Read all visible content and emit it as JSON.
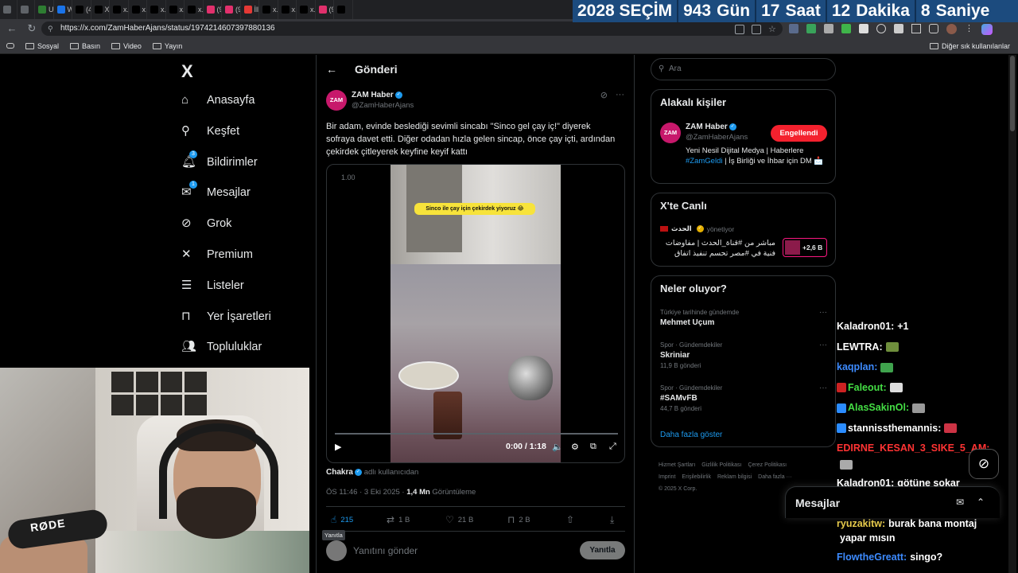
{
  "browser": {
    "tabs": [
      {
        "label": "",
        "color": "#5f6368"
      },
      {
        "label": "",
        "color": "#5f6368"
      },
      {
        "label": "URL",
        "color": "#2e7d32"
      },
      {
        "label": "Wat",
        "color": "#1a73e8"
      },
      {
        "label": "(4) X",
        "color": "#000000"
      },
      {
        "label": "X'te",
        "color": "#000000"
      },
      {
        "label": "x.co",
        "color": "#000000"
      },
      {
        "label": "x.co",
        "color": "#000000"
      },
      {
        "label": "x.co",
        "color": "#000000"
      },
      {
        "label": "x.co",
        "color": "#000000"
      },
      {
        "label": "x.co",
        "color": "#000000"
      },
      {
        "label": "(9) I",
        "color": "#e1306c"
      },
      {
        "label": "(9) I",
        "color": "#e1306c"
      },
      {
        "label": "İlk o",
        "color": "#e53935"
      },
      {
        "label": "x.co",
        "color": "#000000"
      },
      {
        "label": "x.co",
        "color": "#000000"
      },
      {
        "label": "x.co",
        "color": "#000000"
      },
      {
        "label": "(9) I",
        "color": "#e1306c"
      },
      {
        "label": "",
        "color": "#000000"
      }
    ],
    "url": "https://x.com/ZamHaberAjans/status/1974214607397880136",
    "bookmarks": [
      "Sosyal",
      "Basın",
      "Video",
      "Yayın"
    ],
    "bookmarks_other": "Diğer sık kullanılanlar"
  },
  "countdown": {
    "title": "2028 SEÇİM",
    "days": "943",
    "days_label": "Gün",
    "hours": "17",
    "hours_label": "Saat",
    "minutes": "12",
    "minutes_label": "Dakika",
    "seconds": "8",
    "seconds_label": "Saniye"
  },
  "nav": {
    "logo": "X",
    "items": [
      {
        "label": "Anasayfa",
        "icon": "home-icon"
      },
      {
        "label": "Keşfet",
        "icon": "search-icon"
      },
      {
        "label": "Bildirimler",
        "icon": "bell-icon",
        "badge": "3"
      },
      {
        "label": "Mesajlar",
        "icon": "mail-icon",
        "badge": "1"
      },
      {
        "label": "Grok",
        "icon": "grok-icon"
      },
      {
        "label": "Premium",
        "icon": "x-icon"
      },
      {
        "label": "Listeler",
        "icon": "list-icon"
      },
      {
        "label": "Yer İşaretleri",
        "icon": "bookmark-icon"
      },
      {
        "label": "Topluluklar",
        "icon": "people-icon"
      }
    ]
  },
  "post": {
    "header": "Gönderi",
    "author_name": "ZAM Haber",
    "author_handle": "@ZamHaberAjans",
    "avatar_text": "ZAM",
    "text": "Bir adam, evinde beslediği sevimli sincabı \"Sinco gel çay iç!\" diyerek sofraya davet etti. Diğer odadan hızla gelen sincap, önce çay içti, ardından çekirdek çitleyerek keyfine keyif kattı",
    "video": {
      "caption": "Sinco ile çay için çekirdek yiyoruz 😂",
      "speed": "1.00",
      "time": "0:00 / 1:18",
      "progress": 0
    },
    "source_name": "Chakra",
    "source_rest": "adlı kullanıcıdan",
    "timestamp": "ÖS 11:46 · 3 Eki 2025 · ",
    "views": "1,4 Mn",
    "views_label": " Görüntüleme",
    "stats": {
      "replies": "215",
      "reposts": "1 B",
      "likes": "21 B",
      "bookmarks": "2 B"
    },
    "tooltip": "Yanıtla",
    "reply_placeholder": "Yanıtını gönder",
    "reply_button": "Yanıtla"
  },
  "sidebar": {
    "search_placeholder": "Ara",
    "related": {
      "title": "Alakalı kişiler",
      "name": "ZAM Haber",
      "handle": "@ZamHaberAjans",
      "button": "Engellendi",
      "bio_prefix": "Yeni Nesil Dijital Medya | Haberlere ",
      "bio_tag": "#ZamGeldi",
      "bio_suffix": " | İş Birliği ve İhbar için DM 📩"
    },
    "live": {
      "title": "X'te Canlı",
      "host": "الحدث",
      "host_suffix": "yönetiyor",
      "stream_title": "مباشر من #قناة_الحدث | مفاوضات فنية في #مصر تحسم تنفيذ اتفاق",
      "listeners": "+2,6 B"
    },
    "trends": {
      "title": "Neler oluyor?",
      "items": [
        {
          "context": "Türkiye tarihinde gündemde",
          "name": "Mehmet Uçum",
          "count": ""
        },
        {
          "context": "Spor · Gündemdekiler",
          "name": "Skriniar",
          "count": "11,9 B gönderi"
        },
        {
          "context": "Spor · Gündemdekiler",
          "name": "#SAMvFB",
          "count": "44,7 B gönderi"
        }
      ],
      "more": "Daha fazla göster"
    },
    "footer": [
      "Hizmet Şartları",
      "Gizlilik Politikası",
      "Çerez Politikası",
      "Imprint",
      "Erişilebilirlik",
      "Reklam bilgisi",
      "Daha fazla ···",
      "© 2025 X Corp."
    ]
  },
  "chat": [
    {
      "user": "Kaladron01:",
      "text": "+1",
      "color": "#ffffff",
      "emote": ""
    },
    {
      "user": "LEWTRA:",
      "text": "",
      "color": "#ffffff",
      "emote": "#6f8f3c"
    },
    {
      "user": "kaqplan:",
      "text": "",
      "color": "#3d8bff",
      "emote": "#3fa34d"
    },
    {
      "user": "Faleout:",
      "text": "",
      "color": "#44dd44",
      "emote": "#dddddd",
      "prefix": "#cc2222"
    },
    {
      "user": "AlasSakinOl:",
      "text": "",
      "color": "#44dd44",
      "emote": "#999999",
      "prefix": "#2b8cff"
    },
    {
      "user": "stannissthemannis:",
      "text": "",
      "color": "#ffffff",
      "emote": "#cc3344",
      "prefix": "#2b8cff"
    },
    {
      "user": "EDIRNE_KESAN_3_SIKE_5_AM:",
      "text": "",
      "color": "#ff3333",
      "emote": ""
    },
    {
      "user": "",
      "text": "",
      "color": "#ffffff",
      "emote": "#aaaaaa"
    },
    {
      "user": "Kaladron01:",
      "text": "götüne sokar",
      "color": "#ffffff",
      "emote": ""
    },
    {
      "user": "KokBilig:",
      "text": "",
      "color": "#44dd44",
      "emote": "#c8a07a",
      "prefix": "#e5c94a"
    },
    {
      "user": "ryuzakitw:",
      "text": "burak bana montaj",
      "color": "#e5c94a",
      "emote": ""
    },
    {
      "user": "",
      "text": "yapar mısın",
      "color": "#ffffff",
      "emote": ""
    },
    {
      "user": "FlowtheGreatt:",
      "text": "singo?",
      "color": "#3d8bff",
      "emote": ""
    }
  ],
  "dm_bar": {
    "title": "Mesajlar"
  }
}
